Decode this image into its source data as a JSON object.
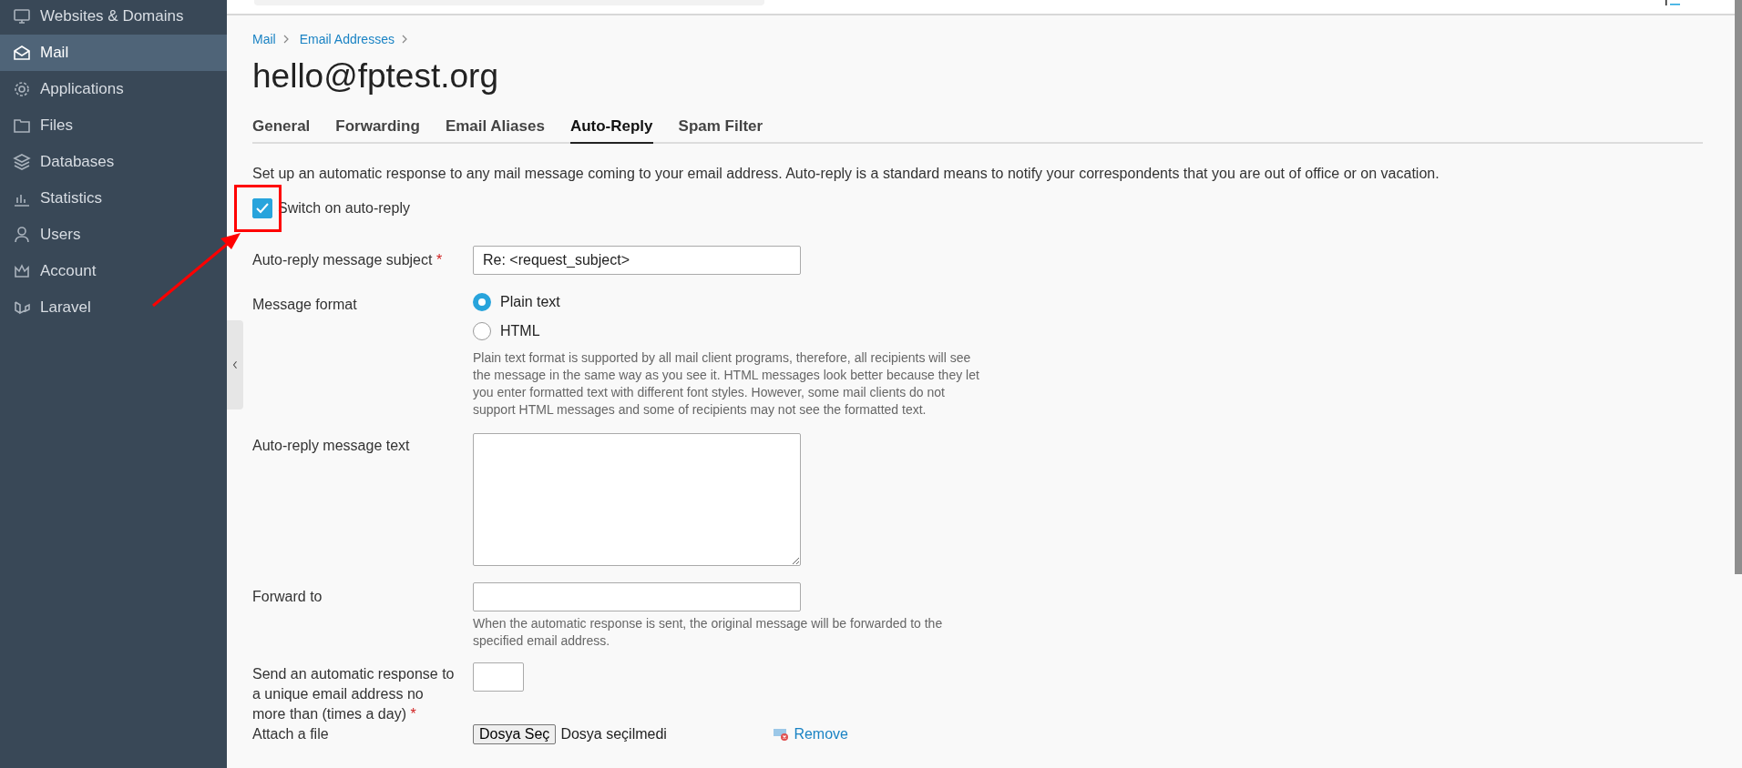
{
  "sidebar": {
    "items": [
      {
        "label": "Websites & Domains",
        "selected": false
      },
      {
        "label": "Mail",
        "selected": true
      },
      {
        "label": "Applications",
        "selected": false
      },
      {
        "label": "Files",
        "selected": false
      },
      {
        "label": "Databases",
        "selected": false
      },
      {
        "label": "Statistics",
        "selected": false
      },
      {
        "label": "Users",
        "selected": false
      },
      {
        "label": "Account",
        "selected": false
      },
      {
        "label": "Laravel",
        "selected": false
      }
    ]
  },
  "breadcrumb": [
    "Mail",
    "Email Addresses"
  ],
  "title": "hello@fptest.org",
  "tabs": [
    {
      "label": "General",
      "selected": false
    },
    {
      "label": "Forwarding",
      "selected": false
    },
    {
      "label": "Email Aliases",
      "selected": false
    },
    {
      "label": "Auto-Reply",
      "selected": true
    },
    {
      "label": "Spam Filter",
      "selected": false
    }
  ],
  "description": "Set up an automatic response to any mail message coming to your email address. Auto-reply is a standard means to notify your correspondents that you are out of office or on vacation.",
  "auto_reply_switch": {
    "label": "Switch on auto-reply",
    "checked": true
  },
  "form": {
    "subject": {
      "label": "Auto-reply message subject",
      "required_mark": "*",
      "value": "Re: <request_subject>"
    },
    "message_format": {
      "label": "Message format",
      "options": [
        {
          "label": "Plain text",
          "selected": true
        },
        {
          "label": "HTML",
          "selected": false
        }
      ],
      "hint": "Plain text format is supported by all mail client programs, therefore, all recipients will see the message in the same way as you see it. HTML messages look better because they let you enter formatted text with different font styles. However, some mail clients do not support HTML messages and some of recipients may not see the formatted text."
    },
    "message_text": {
      "label": "Auto-reply message text"
    },
    "forward_to": {
      "label": "Forward to",
      "hint": "When the automatic response is sent, the original message will be forwarded to the specified email address."
    },
    "daily_limit": {
      "label": "Send an automatic response to a unique email address no more than (times a day)",
      "required_mark": "*"
    },
    "attach": {
      "label": "Attach a file",
      "button": "Dosya Seç",
      "status": "Dosya seçilmedi",
      "remove": "Remove"
    }
  }
}
